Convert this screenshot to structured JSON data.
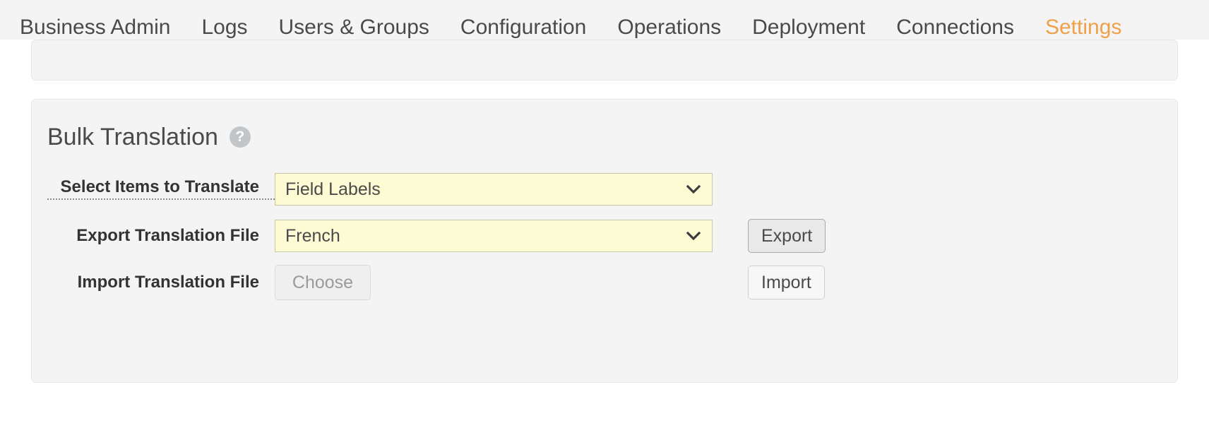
{
  "nav": {
    "items": [
      {
        "label": "Business Admin",
        "active": false
      },
      {
        "label": "Logs",
        "active": false
      },
      {
        "label": "Users & Groups",
        "active": false
      },
      {
        "label": "Configuration",
        "active": false
      },
      {
        "label": "Operations",
        "active": false
      },
      {
        "label": "Deployment",
        "active": false
      },
      {
        "label": "Connections",
        "active": false
      },
      {
        "label": "Settings",
        "active": true
      }
    ],
    "active_color": "#f0a049",
    "inactive_color": "#4a4a4a"
  },
  "section": {
    "title": "Bulk Translation",
    "help_icon": "question-mark-icon",
    "help_icon_glyph": "?"
  },
  "form": {
    "rows": [
      {
        "label": "Select Items to Translate",
        "has_hint_underline": true,
        "control": "select",
        "value": "Field Labels",
        "action": null
      },
      {
        "label": "Export Translation File",
        "has_hint_underline": false,
        "control": "select",
        "value": "French",
        "action": "Export"
      },
      {
        "label": "Import Translation File",
        "has_hint_underline": false,
        "control": "file",
        "value": "Choose",
        "action": "Import"
      }
    ]
  },
  "colors": {
    "select_background": "#fdfbd4",
    "select_border": "#c9c7ab",
    "card_background": "#f4f4f4",
    "page_background": "#ffffff"
  }
}
